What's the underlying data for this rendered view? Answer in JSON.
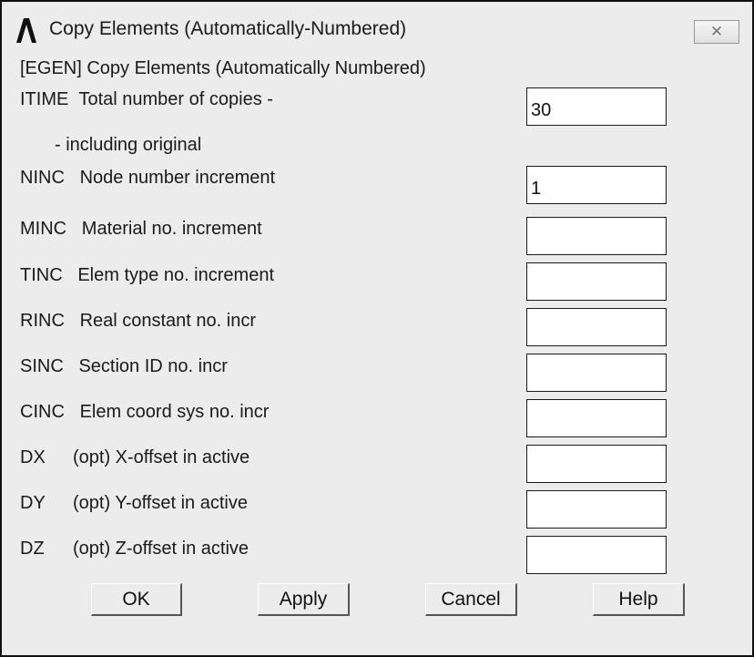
{
  "window": {
    "title": "Copy Elements (Automatically-Numbered)",
    "close_glyph": "✕"
  },
  "dialog": {
    "header": "[EGEN]  Copy Elements (Automatically Numbered)",
    "rows": [
      {
        "code": "ITIME",
        "label": "Total number of copies -",
        "value": ""
      },
      {
        "sub": "- including original"
      },
      {
        "code": "NINC",
        "label": "Node number increment",
        "value": "1"
      },
      {
        "code": "MINC",
        "label": "Material no. increment",
        "value": ""
      },
      {
        "code": "TINC",
        "label": "Elem type no. increment",
        "value": ""
      },
      {
        "code": "RINC",
        "label": "Real constant no. incr",
        "value": ""
      },
      {
        "code": "SINC",
        "label": "Section ID no. incr",
        "value": ""
      },
      {
        "code": "CINC",
        "label": "Elem coord sys no. incr",
        "value": ""
      },
      {
        "code": "DX",
        "label": "(opt) X-offset in active",
        "value": ""
      },
      {
        "code": "DY",
        "label": "(opt) Y-offset in active",
        "value": ""
      },
      {
        "code": "DZ",
        "label": "(opt) Z-offset in active",
        "value": ""
      }
    ],
    "itime_value": "30"
  },
  "buttons": {
    "ok": "OK",
    "apply": "Apply",
    "cancel": "Cancel",
    "help": "Help"
  },
  "icons": {
    "app_logo": "ansys-logo-icon",
    "close": "close-icon"
  }
}
